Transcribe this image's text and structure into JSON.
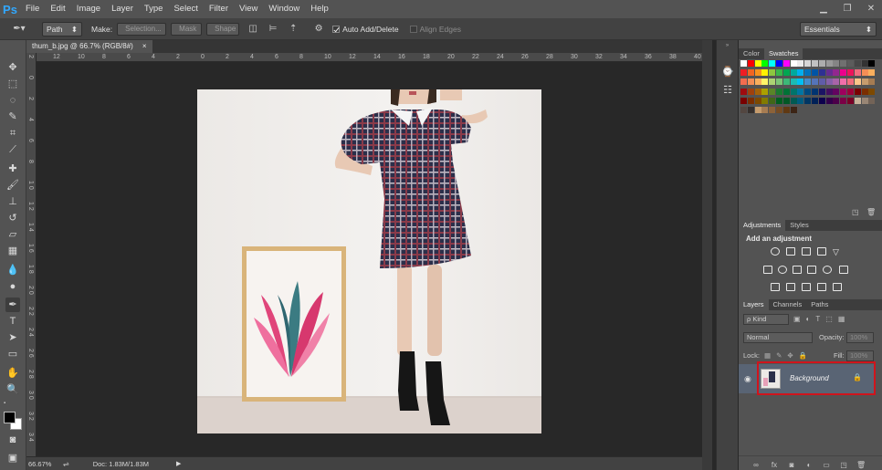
{
  "app": {
    "logo": "Ps"
  },
  "menu": [
    "File",
    "Edit",
    "Image",
    "Layer",
    "Type",
    "Select",
    "Filter",
    "View",
    "Window",
    "Help"
  ],
  "options": {
    "mode": "Path",
    "make_label": "Make:",
    "selection": "Selection...",
    "mask": "Mask",
    "shape": "Shape",
    "auto_add": "Auto Add/Delete",
    "align_edges": "Align Edges",
    "workspace": "Essentials"
  },
  "document": {
    "tab": "thum_b.jpg @ 66.7% (RGB/8#)",
    "close": "×"
  },
  "ruler_top": [
    "12",
    "10",
    "8",
    "6",
    "4",
    "2",
    "0",
    "2",
    "4",
    "6",
    "8",
    "10",
    "12",
    "14",
    "16",
    "18",
    "20",
    "22",
    "24",
    "26",
    "28",
    "30",
    "32",
    "34",
    "36",
    "38",
    "40"
  ],
  "ruler_left": [
    "2",
    "0",
    "2",
    "4",
    "6",
    "8",
    "1 0",
    "1 2",
    "1 4",
    "1 6",
    "1 8",
    "2 0",
    "2 2",
    "2 4",
    "2 6",
    "2 8",
    "3 0",
    "3 2",
    "3 4"
  ],
  "status": {
    "zoom": "66.67%",
    "doc": "Doc: 1.83M/1.83M"
  },
  "panels": {
    "color_tab": "Color",
    "swatches_tab": "Swatches",
    "adjustments_tab": "Adjustments",
    "styles_tab": "Styles",
    "add_adjustment": "Add an adjustment",
    "layers_tab": "Layers",
    "channels_tab": "Channels",
    "paths_tab": "Paths",
    "kind": "ρ Kind",
    "blend": "Normal",
    "opacity_label": "Opacity:",
    "opacity": "100%",
    "lock_label": "Lock:",
    "fill_label": "Fill:",
    "fill": "100%",
    "layer_name": "Background"
  },
  "colors": {
    "accent_highlight": "#d0141c",
    "layer_selected": "#596474",
    "swatches": [
      [
        "#ffffff",
        "#ff0000",
        "#ffff00",
        "#00ff00",
        "#00ffff",
        "#0000ff",
        "#ff00ff",
        "#ffffff",
        "#ebebeb",
        "#d6d6d6",
        "#c2c2c2",
        "#adadad",
        "#999999",
        "#858585",
        "#707070",
        "#5c5c5c",
        "#474747",
        "#333333",
        "#000000"
      ],
      [
        "#ee1d24",
        "#f26522",
        "#f7941d",
        "#fff200",
        "#8dc63f",
        "#39b54a",
        "#00a651",
        "#00a99d",
        "#00aeef",
        "#0072bc",
        "#0054a6",
        "#2e3192",
        "#662d91",
        "#92278f",
        "#ec008c",
        "#ed145b",
        "#f26d7d",
        "#f68e56",
        "#fbaf5d"
      ],
      [
        "#f26c4f",
        "#f68e56",
        "#fbaf5d",
        "#fff568",
        "#acd373",
        "#7cc576",
        "#3cb878",
        "#1cbbb4",
        "#00bff3",
        "#448ccb",
        "#5574b9",
        "#605ca8",
        "#8560a8",
        "#a864a8",
        "#f06eaa",
        "#f26d7d",
        "#fdc689",
        "#c69c6e",
        "#a67c52"
      ],
      [
        "#9e0b0f",
        "#a0410d",
        "#a36209",
        "#aba000",
        "#598527",
        "#1a7b30",
        "#007236",
        "#00746b",
        "#0076a3",
        "#004a80",
        "#003471",
        "#1b1464",
        "#440e62",
        "#630460",
        "#9e005d",
        "#9e0039",
        "#790000",
        "#7b2e00",
        "#7d4900"
      ],
      [
        "#790000",
        "#7b2e00",
        "#7d4900",
        "#827b00",
        "#406618",
        "#005e20",
        "#005826",
        "#005952",
        "#005b7f",
        "#003663",
        "#002157",
        "#0d004c",
        "#32004b",
        "#4b0049",
        "#7b0046",
        "#7a0026",
        "#c7b299",
        "#998675",
        "#736357"
      ],
      [
        "#534741",
        "#37302d",
        "#c69c6d",
        "#a67c52",
        "#8c6239",
        "#754c24",
        "#603913",
        "#3c2415"
      ]
    ]
  }
}
